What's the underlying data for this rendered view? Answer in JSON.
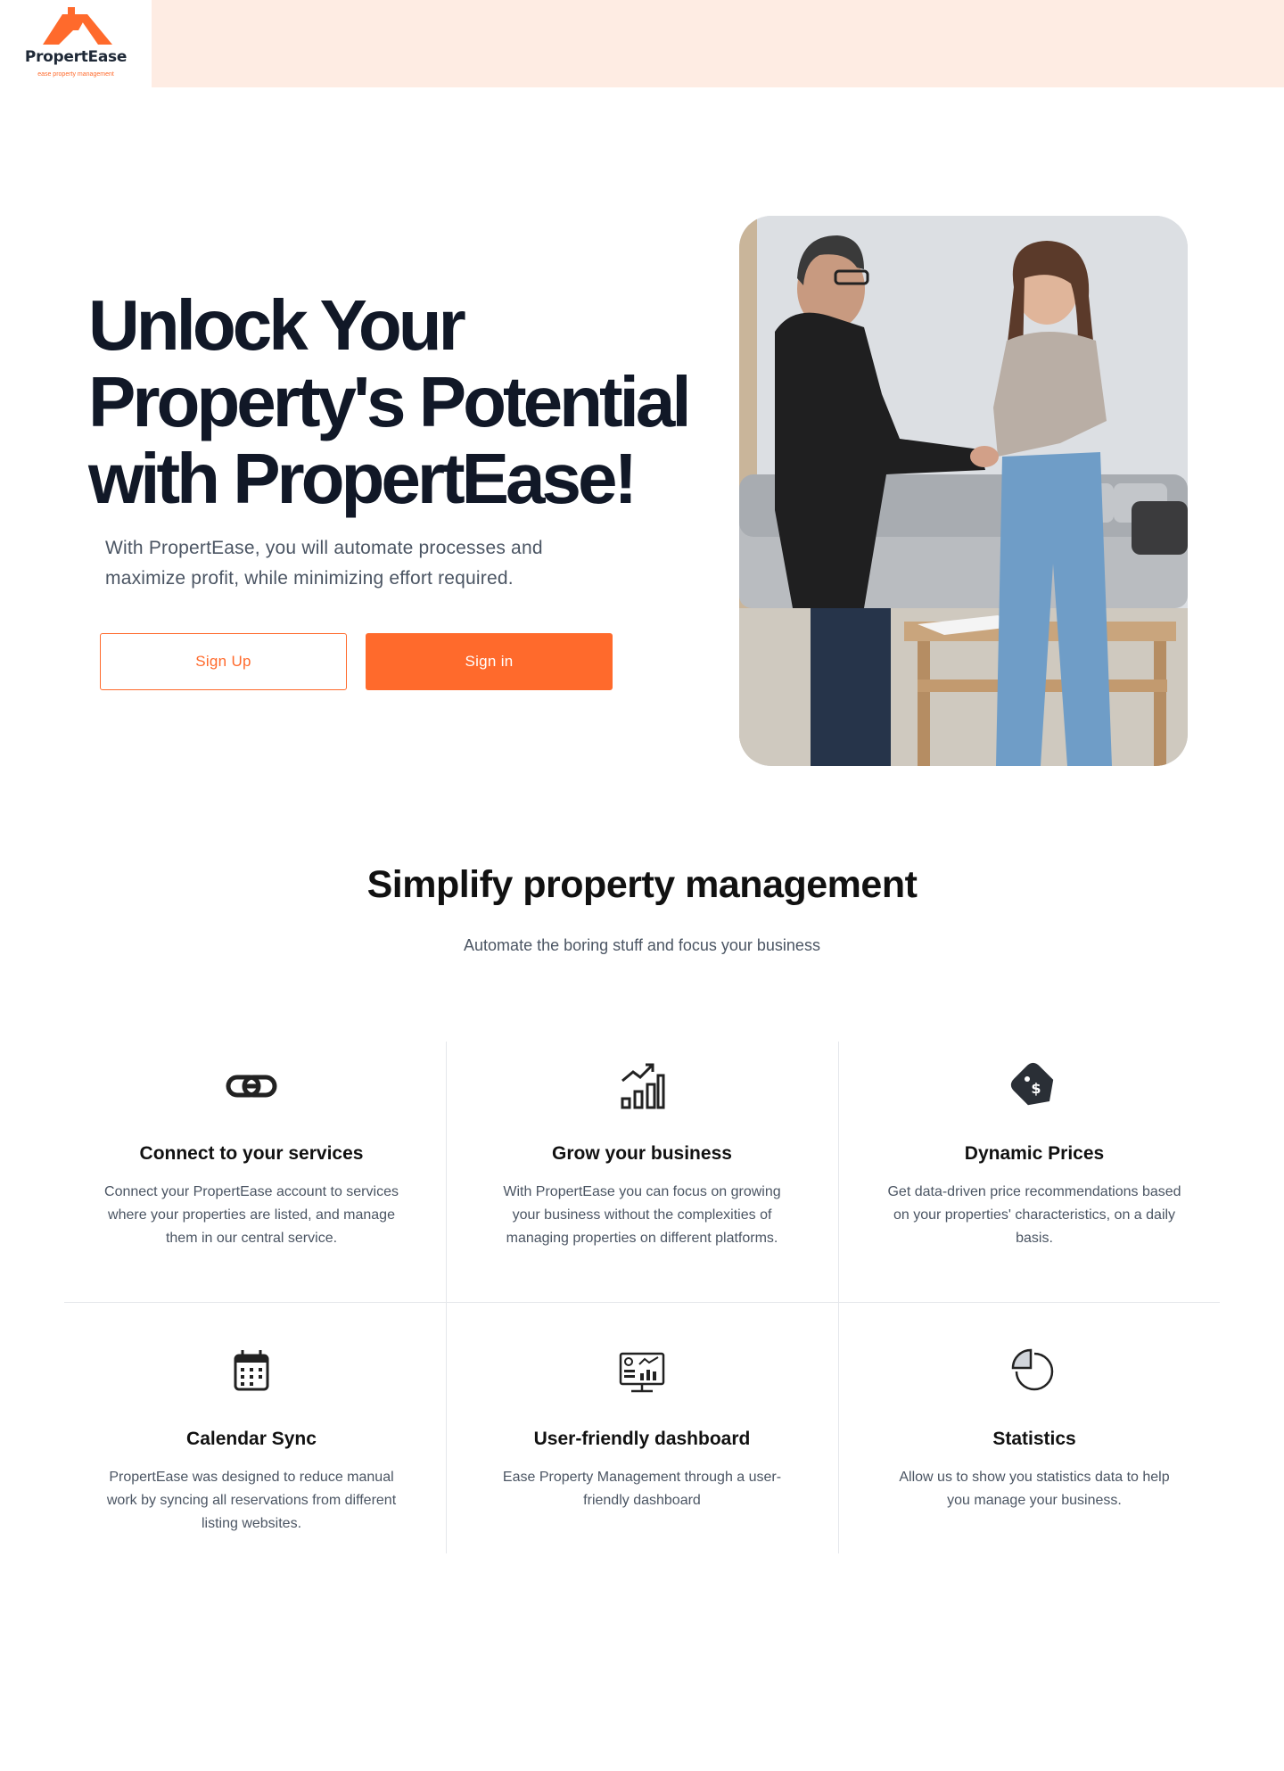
{
  "brand": {
    "name": "PropertEase",
    "tagline": "ease property management",
    "accent": "#ff6a2c",
    "band_color": "#feece3"
  },
  "hero": {
    "title": "Unlock Your Property's Potential with PropertEase!",
    "subtitle": "With PropertEase, you will automate processes and maximize profit, while minimizing effort required.",
    "signup_label": "Sign Up",
    "signin_label": "Sign in"
  },
  "features_section": {
    "title": "Simplify property management",
    "subtitle": "Automate the boring stuff and focus your business",
    "items": [
      {
        "icon": "link-icon",
        "title": "Connect to your services",
        "text": "Connect your PropertEase account to services where your properties are listed, and manage them in our central service."
      },
      {
        "icon": "growth-chart-icon",
        "title": "Grow your business",
        "text": "With PropertEase you can focus on growing your business without the complexities of managing properties on different platforms."
      },
      {
        "icon": "price-tag-icon",
        "title": "Dynamic Prices",
        "text": "Get data-driven price recommendations based  on your properties' characteristics, on a daily basis."
      },
      {
        "icon": "calendar-icon",
        "title": "Calendar Sync",
        "text": "PropertEase was designed to reduce manual work by syncing all reservations from  different listing websites."
      },
      {
        "icon": "dashboard-icon",
        "title": "User-friendly dashboard",
        "text": "Ease Property Management through a user-friendly dashboard"
      },
      {
        "icon": "pie-chart-icon",
        "title": "Statistics",
        "text": "Allow us to show you statistics data to help you manage your business."
      }
    ]
  }
}
